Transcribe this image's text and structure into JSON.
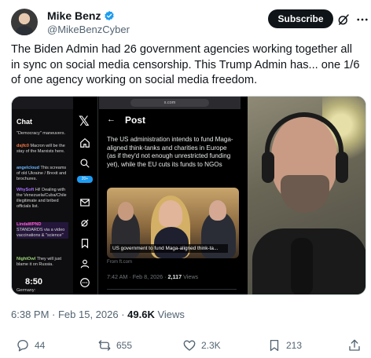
{
  "author": {
    "display_name": "Mike Benz",
    "handle": "@MikeBenzCyber",
    "verified": true,
    "subscribe_label": "Subscribe"
  },
  "tweet": {
    "text": "The Biden Admin had 26 government agencies working together all in sync on social media censorship. This Trump Admin has... one 1/6 of one agency working on social media freedom.",
    "time": "6:38 PM · Feb 15, 2026 · ",
    "views_count": "49.6K",
    "views_label": "Views"
  },
  "media": {
    "chat_title": "Chat",
    "chat_lines": [
      {
        "user": "",
        "text": "\"Democracy\" maneuvers."
      },
      {
        "user": "dsjfc0",
        "text": "Macron will be the stay of the Marxists here."
      },
      {
        "user": "angelcloud",
        "text": "This screams of old Ukraine / Brexit and brochures."
      },
      {
        "user": "WhySoft",
        "text": "Hi! Dealing with the Venezuela/Cuba/Chile illegitimate and bribed officials list."
      },
      {
        "user": "LindaWPND",
        "text": "STANDARDS via a video vaccinations & \"science\""
      },
      {
        "user": "NightOwl",
        "text": "They will just blame it on Russia."
      },
      {
        "user": "",
        "text": "Germany:"
      }
    ],
    "stream_time": "8:50",
    "browser_url": "x.com",
    "post_header": "Post",
    "post_text": "The US administration intends to fund Maga-aligned think-tanks and charities in Europe (as if they'd not enough unrestricted funding yet), while the EU cuts its funds to NGOs",
    "image_caption": "US government to fund Maga-aligned think-ta...",
    "image_source": "From ft.com",
    "post_time": "7:42 AM · Feb 8, 2026 · ",
    "post_views_count": "2,117",
    "post_views_label": "Views",
    "nav_badge": "20+"
  },
  "actions": {
    "replies": "44",
    "reposts": "655",
    "likes": "2.3K",
    "bookmarks": "213"
  },
  "colors": {
    "verified_blue": "#1d9bf0",
    "text_primary": "#0f1419",
    "text_secondary": "#536471"
  }
}
